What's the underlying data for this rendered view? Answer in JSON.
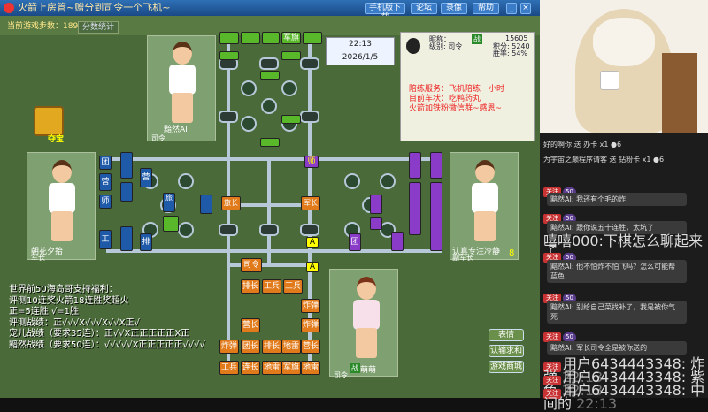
{
  "window": {
    "title": "火箭上房管~赠分到司令一个飞机~",
    "buttons": {
      "handbook": "手机版下载",
      "chat": "论坛",
      "record": "录像",
      "help": "帮助"
    }
  },
  "info": {
    "steps_label": "当前游戏步数：189",
    "stats_button": "分数统计"
  },
  "players": {
    "top": {
      "name": "黯然AI",
      "rank": "司令"
    },
    "left": {
      "name": "朝花夕拾",
      "rank": "军长"
    },
    "right": {
      "name": "认真专注冷静",
      "rank": "副军长",
      "level": "8"
    },
    "bottom": {
      "name": "萌萌",
      "rank": "司令",
      "badge": "战"
    }
  },
  "treasure_label": "夺宝",
  "clock": {
    "time": "22:13",
    "date": "2026/1/5"
  },
  "profile": {
    "nickname_label": "昵称：",
    "level_label": "级别: 司令",
    "score_label": "积分: 5240",
    "rate_label": "胜率: 54%",
    "gold": "15605",
    "tag": "战"
  },
  "promo": [
    "陪练服务：飞机陪练一小时",
    "目前车状：吃鸭药丸",
    "火箭加铁粉微信群~感恩~"
  ],
  "welfare": [
    "世界前50海岛哥支持福利：",
    "评测10连奖火箭18连胜奖超火",
    "正=5连胜 √=1胜",
    "评测战绩：正√√√X√√√X√√X正√",
    "宠儿战绩（要求35连）：正√√X正正正正正X正",
    "黯然战绩（要求50连）：√√√√√X正正正正正√√√√"
  ],
  "board": {
    "top_pieces": [
      "军旗"
    ],
    "left_labels": [
      "团",
      "营",
      "排",
      "旅",
      "连",
      "师",
      "营",
      "工"
    ],
    "center_labels": [
      "旅长",
      "军长"
    ],
    "right_labels": [
      "师",
      "团",
      "A",
      "A"
    ],
    "bottom_pieces": [
      [
        "司令"
      ],
      [
        "排长",
        "工兵",
        "工兵"
      ],
      [
        "炸弹"
      ],
      [
        "营长",
        "炸弹"
      ],
      [
        "炸弹",
        "团长",
        "排长",
        "地雷",
        "营长"
      ],
      [
        "工兵",
        "连长",
        "地雷",
        "军旗",
        "地雷"
      ]
    ]
  },
  "right_buttons": {
    "emote": "表情",
    "leave": "认输求和",
    "exit": "游戏商城"
  },
  "chat": {
    "gift1_user": "好的啊你",
    "gift1_text": "送 办卡",
    "gift1_count": "x1 ●6",
    "gift2_text": "为宇宙之巅程序请客 送 钻粉卡",
    "gift2_count": "x1 ●6",
    "follow": "关注",
    "user_ai": "黯然AI",
    "lv": "50",
    "m1": "我还有个毛的炸",
    "m2": "跟你说五十连胜，太坑了",
    "m3_user": "嘻嘻000:",
    "m3": "下棋怎么聊起来了",
    "m4": "他不怕炸不怕飞吗？怎么可能帮",
    "m4b": "蓝色",
    "m5": "别给自己菜找补了，我是被你气",
    "m5b": "死",
    "m6": "军长司令全是被你送的",
    "u1": "用户6434443348:",
    "t1": "炸弹",
    "u2": "用户6434443348:",
    "t2": "紫色",
    "u3": "用户6434443348:",
    "t3": "中间的",
    "ts": "22:13"
  }
}
